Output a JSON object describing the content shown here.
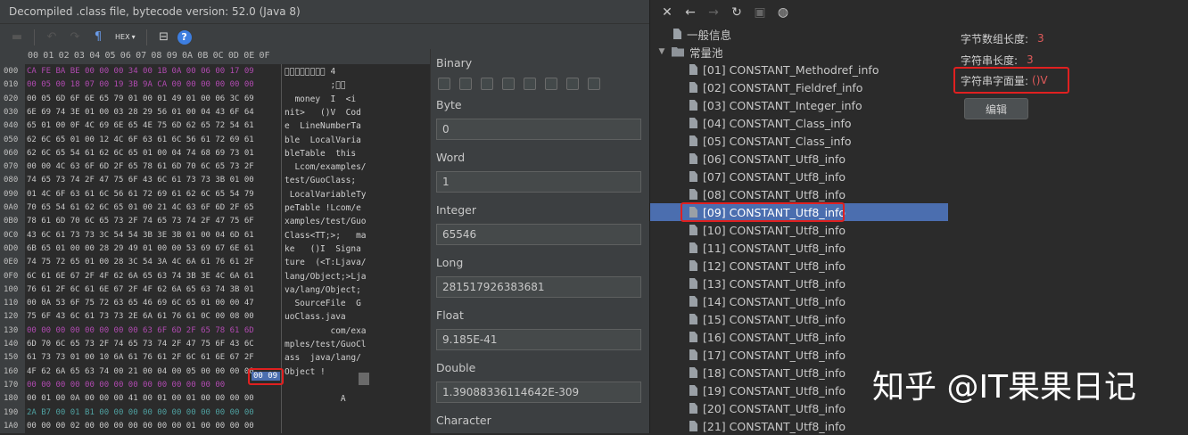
{
  "window": {
    "title": "Decompiled .class file, bytecode version: 52.0 (Java 8)"
  },
  "toolbar": {
    "icons": [
      "save-icon",
      "undo-icon",
      "redo-icon",
      "pilcrow-icon",
      "hex-mode-icon",
      "dropdown-icon",
      "columns-icon",
      "help-icon"
    ],
    "pilcrow": "¶",
    "hex_label": "HEX",
    "help": "?"
  },
  "hex_header": [
    "00",
    "01",
    "02",
    "03",
    "04",
    "05",
    "06",
    "07",
    "08",
    "09",
    "0A",
    "0B",
    "0C",
    "0D",
    "0E",
    "0F"
  ],
  "offsets": [
    "000",
    "010",
    "020",
    "030",
    "040",
    "050",
    "060",
    "070",
    "080",
    "090",
    "0A0",
    "0B0",
    "0C0",
    "0D0",
    "0E0",
    "0F0",
    "100",
    "110",
    "120",
    "130",
    "140",
    "150",
    "160",
    "170",
    "180",
    "190",
    "1A0"
  ],
  "hex_rows": [
    "CA FE BA BE 00 00 00 34 00 1B 0A 00 06 00 17 09",
    "00 05 00 18 07 00 19 3B 9A CA 00 00 00 00 00 00",
    "00 05 6D 6F 6E 65 79 01 00 01 49 01 00 06 3C 69",
    "6E 69 74 3E 01 00 03 28 29 56 01 00 04 43 6F 64",
    "65 01 00 0F 4C 69 6E 65 4E 75 6D 62 65 72 54 61",
    "62 6C 65 01 00 12 4C 6F 63 61 6C 56 61 72 69 61",
    "62 6C 65 54 61 62 6C 65 01 00 04 74 68 69 73 01",
    "00 00 4C 63 6F 6D 2F 65 78 61 6D 70 6C 65 73 2F",
    "74 65 73 74 2F 47 75 6F 43 6C 61 73 73 3B 01 00",
    "01 4C 6F 63 61 6C 56 61 72 69 61 62 6C 65 54 79",
    "70 65 54 61 62 6C 65 01 00 21 4C 63 6F 6D 2F 65",
    "78 61 6D 70 6C 65 73 2F 74 65 73 74 2F 47 75 6F",
    "43 6C 61 73 73 3C 54 54 3B 3E 3B 01 00 04 6D 61",
    "6B 65 01 00 00 28 29 49 01 00 00 53 69 67 6E 61",
    "74 75 72 65 01 00 28 3C 54 3A 4C 6A 61 76 61 2F",
    "6C 61 6E 67 2F 4F 62 6A 65 63 74 3B 3E 4C 6A 61",
    "76 61 2F 6C 61 6E 67 2F 4F 62 6A 65 63 74 3B 01",
    "00 0A 53 6F 75 72 63 65 46 69 6C 65 01 00 00 47",
    "75 6F 43 6C 61 73 73 2E 6A 61 76 61 0C 00 08 00",
    "00 00 00 00 00 00 00 00 63 6F 6D 2F 65 78 61 6D",
    "6D 70 6C 65 73 2F 74 65 73 74 2F 47 75 6F 43 6C",
    "61 73 73 01 00 10 6A 61 76 61 2F 6C 61 6E 67 2F",
    "4F 62 6A 65 63 74 00 21 00 04 00 05 00 00 00 00",
    "00 00 00 00 00 00 00 00 00 00 00 00 00 00",
    "00 01 00 0A 00 00 00 41 00 01 00 01 00 00 00 00",
    "2A B7 00 01 B1 00 00 00 00 00 00 00 00 00 00 00",
    "00 00 00 02 00 00 00 00 00 00 00 01 00 00 00 00"
  ],
  "ascii_rows": [
    "\u0000\u0000\u0000\u0000\u0000\u0000\u0000\u0000 4",
    "         ;\u0000\u0000",
    "  money  I  <i",
    "nit>   ()V  Cod",
    "e  LineNumberTa",
    "ble  LocalVaria",
    "bleTable  this",
    "  Lcom/examples/",
    "test/GuoClass;",
    " LocalVariableTy",
    "peTable !Lcom/e",
    "xamples/test/Guo",
    "Class<TT;>;   ma",
    "ke   ()I  Signa",
    "ture  (<T:Ljava/",
    "lang/Object;>Lja",
    "va/lang/Object;",
    "  SourceFile  G",
    "uoClass.java",
    "         com/exa",
    "mples/test/GuoCl",
    "ass  java/lang/",
    "Object !",
    "",
    "           A",
    "",
    ""
  ],
  "selected_hex": "00 09",
  "inspector": {
    "binary_label": "Binary",
    "byte_label": "Byte",
    "byte_value": "0",
    "word_label": "Word",
    "word_value": "1",
    "integer_label": "Integer",
    "integer_value": "65546",
    "long_label": "Long",
    "long_value": "281517926383681",
    "float_label": "Float",
    "float_value": "9.185E-41",
    "double_label": "Double",
    "double_value": "1.39088336114642E-309",
    "character_label": "Character"
  },
  "nav": {
    "icons": [
      "close-icon",
      "back-icon",
      "forward-icon",
      "refresh-icon",
      "save-icon",
      "globe-icon"
    ]
  },
  "tree": {
    "general_info": "一般信息",
    "constant_pool": "常量池",
    "items": [
      "[01] CONSTANT_Methodref_info",
      "[02] CONSTANT_Fieldref_info",
      "[03] CONSTANT_Integer_info",
      "[04] CONSTANT_Class_info",
      "[05] CONSTANT_Class_info",
      "[06] CONSTANT_Utf8_info",
      "[07] CONSTANT_Utf8_info",
      "[08] CONSTANT_Utf8_info",
      "[09] CONSTANT_Utf8_info",
      "[10] CONSTANT_Utf8_info",
      "[11] CONSTANT_Utf8_info",
      "[12] CONSTANT_Utf8_info",
      "[13] CONSTANT_Utf8_info",
      "[14] CONSTANT_Utf8_info",
      "[15] CONSTANT_Utf8_info",
      "[16] CONSTANT_Utf8_info",
      "[17] CONSTANT_Utf8_info",
      "[18] CONSTANT_Utf8_info",
      "[19] CONSTANT_Utf8_info",
      "[20] CONSTANT_Utf8_info",
      "[21] CONSTANT_Utf8_info"
    ]
  },
  "props": {
    "byte_array_length_label": "字节数组长度:",
    "byte_array_length_value": "3",
    "string_length_label": "字符串长度:",
    "string_length_value": "3",
    "string_literal_label": "字符串字面量:",
    "string_literal_value": "()V",
    "edit_button": "编辑"
  },
  "watermark": "知乎 @IT果果日记",
  "colors": {
    "highlight_red": "#e02020",
    "selection_blue": "#4b6eaf",
    "value_red": "#e05a5a"
  }
}
